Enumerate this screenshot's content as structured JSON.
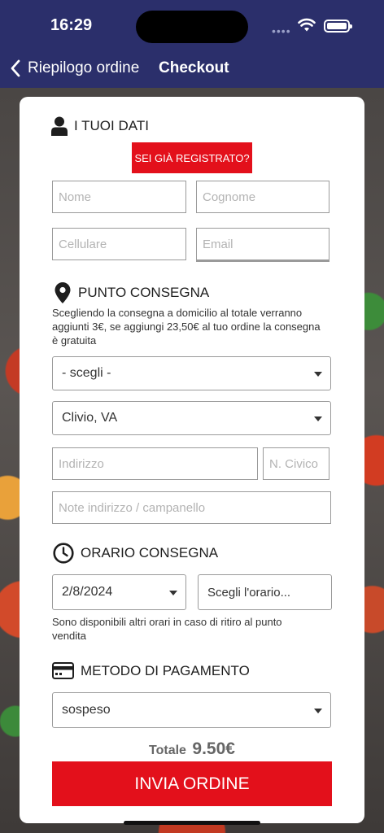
{
  "status_bar": {
    "time": "16:29",
    "signal_dots": "••••"
  },
  "nav": {
    "back_label": "Riepilogo ordine",
    "title": "Checkout"
  },
  "personal": {
    "heading": "I TUOI DATI",
    "registered_button": "SEI GIÀ REGISTRATO?",
    "name_placeholder": "Nome",
    "surname_placeholder": "Cognome",
    "phone_placeholder": "Cellulare",
    "email_placeholder": "Email"
  },
  "delivery": {
    "heading": "PUNTO CONSEGNA",
    "description": "Scegliendo la consegna a domicilio al totale verranno aggiunti 3€, se aggiungi 23,50€ al tuo ordine la consegna è gratuita",
    "point_select": "- scegli -",
    "city_select": "Clivio, VA",
    "address_placeholder": "Indirizzo",
    "civic_placeholder": "N. Civico",
    "notes_placeholder": "Note indirizzo / campanello"
  },
  "schedule": {
    "heading": "ORARIO CONSEGNA",
    "date_select": "2/8/2024",
    "time_field": "Scegli l'orario...",
    "note": "Sono disponibili altri orari in caso di ritiro al punto vendita"
  },
  "payment": {
    "heading": "METODO DI PAGAMENTO",
    "method_select": "sospeso"
  },
  "summary": {
    "total_label": "Totale",
    "total_value": "9.50€"
  },
  "submit_label": "INVIA ORDINE",
  "colors": {
    "nav": "#2b2f6b",
    "accent": "#e3101b"
  }
}
